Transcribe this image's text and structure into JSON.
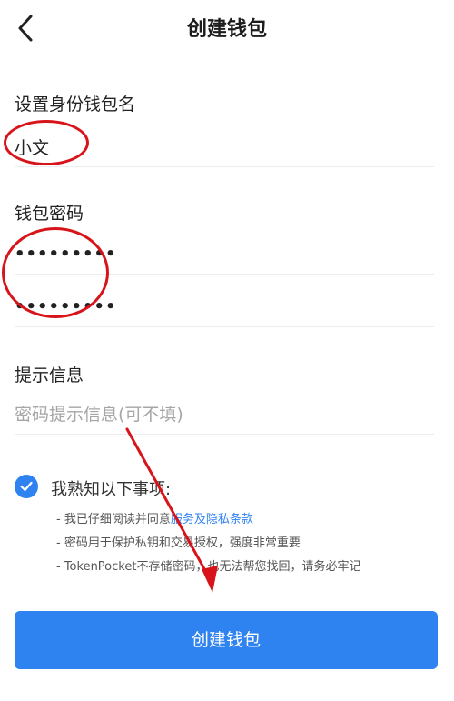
{
  "header": {
    "title": "创建钱包",
    "back_icon": "chevron-left-icon"
  },
  "wallet_name": {
    "label": "设置身份钱包名",
    "value": "小文"
  },
  "password": {
    "label": "钱包密码",
    "value": "•••••••••",
    "confirm_value": "•••••••••"
  },
  "hint": {
    "label": "提示信息",
    "placeholder": "密码提示信息(可不填)"
  },
  "agreement": {
    "title": "我熟知以下事项:",
    "checked": true,
    "line1_prefix": "- 我已仔细阅读并同意服务及隐私条款",
    "line1_link": "服务及隐私条款",
    "line2": "- 密码用于保护私钥和交易授权，强度非常重要",
    "line3": "- TokenPocket不存储密码，也无法帮您找回，请务必牢记"
  },
  "create_button": {
    "label": "创建钱包"
  },
  "colors": {
    "accent": "#2f83f0",
    "annotation": "#d8141b"
  }
}
